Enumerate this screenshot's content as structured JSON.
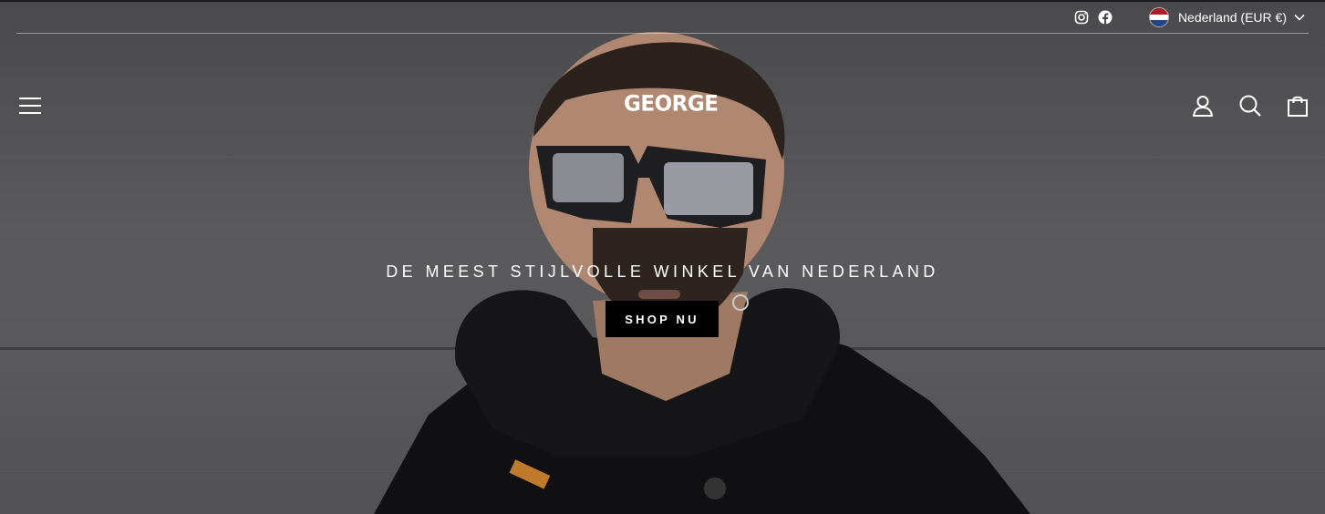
{
  "topbar": {
    "social": [
      {
        "icon": "instagram-icon",
        "label": "Instagram"
      },
      {
        "icon": "facebook-icon",
        "label": "Facebook"
      }
    ],
    "locale": {
      "label": "Nederland (EUR €)",
      "flag_icon": "netherlands-flag-icon",
      "flag_colors": [
        "#ae1c28",
        "#ffffff",
        "#21468b"
      ]
    }
  },
  "header": {
    "logo": "GEORGE",
    "menu_icon": "hamburger-menu-icon",
    "icons": [
      "account-icon",
      "search-icon",
      "cart-icon"
    ]
  },
  "hero": {
    "tagline": "DE MEEST STIJLVOLLE WINKEL VAN NEDERLAND",
    "cta_label": "SHOP NU"
  },
  "colors": {
    "text": "#ffffff",
    "button_bg": "#000000",
    "wall": "#59595b"
  }
}
